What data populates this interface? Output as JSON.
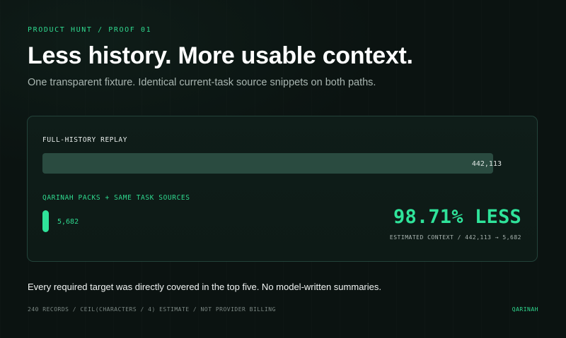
{
  "header": {
    "eyebrow": "PRODUCT HUNT / PROOF 01",
    "title": "Less history. More usable context.",
    "subtitle": "One transparent fixture. Identical current-task source snippets on both paths."
  },
  "comparison": {
    "full_history": {
      "label": "FULL-HISTORY REPLAY",
      "value_text": "442,113",
      "value": 442113,
      "bar_fraction": 1.0
    },
    "qarinah": {
      "label": "QARINAH PACKS + SAME TASK SOURCES",
      "value_text": "5,682",
      "value": 5682,
      "bar_fraction": 0.0129
    },
    "reduction": {
      "headline": "98.71% LESS",
      "caption": "ESTIMATED CONTEXT / 442,113 → 5,682"
    }
  },
  "footnote": "Every required target was directly covered in the top five. No model-written summaries.",
  "footer": {
    "left": "240 RECORDS / CEIL(CHARACTERS / 4) ESTIMATE / NOT PROVIDER BILLING",
    "right": "QARINAH"
  },
  "colors": {
    "accent": "#2fe39a",
    "background": "#0b1311",
    "panel_border": "#23433a",
    "full_bar": "#2a4b40"
  }
}
